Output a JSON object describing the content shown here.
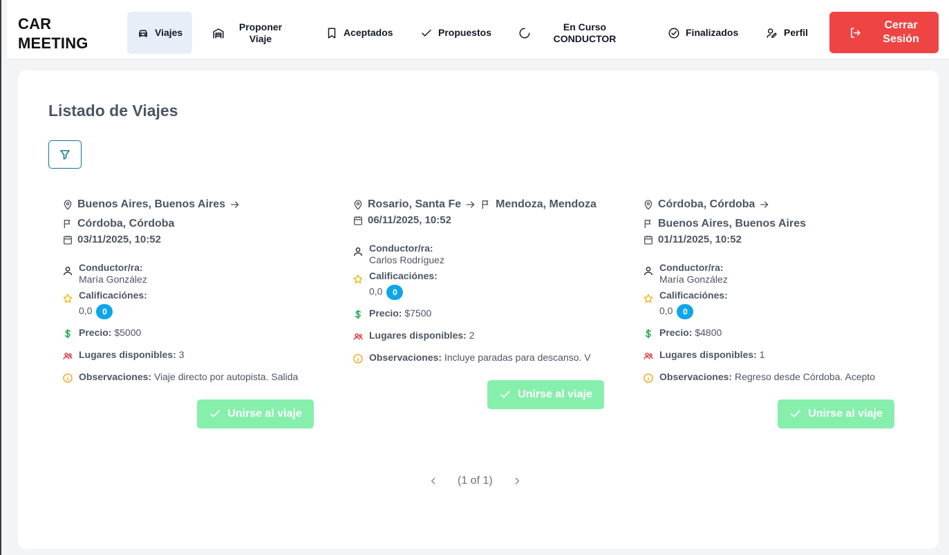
{
  "app": {
    "logo_line1": "CAR",
    "logo_line2": "MEETING"
  },
  "nav": {
    "viajes": "Viajes",
    "proponer_1": "Proponer",
    "proponer_2": "Viaje",
    "aceptados": "Aceptados",
    "propuestos": "Propuestos",
    "encurso_1": "En Curso",
    "encurso_2": "CONDUCTOR",
    "finalizados": "Finalizados",
    "perfil": "Perfil",
    "logout_1": "Cerrar",
    "logout_2": "Sesión"
  },
  "colors": {
    "accent": "#0e7490",
    "logout": "#ef4444",
    "join": "#86efac",
    "badge": "#0ea5e9",
    "active_nav": "#e8eef8"
  },
  "main": {
    "title": "Listado de Viajes"
  },
  "labels": {
    "driver": "Conductor/ra:",
    "ratings": "Calificaciónes:",
    "price": "Precio:",
    "seats": "Lugares disponibles:",
    "notes": "Observaciones:",
    "join": "Unirse al viaje"
  },
  "trips": [
    {
      "origin": "Buenos Aires, Buenos Aires",
      "destination": "Córdoba, Córdoba",
      "date": "03/11/2025, 10:52",
      "driver": "María González",
      "rating": "0,0",
      "rating_count": "0",
      "price": "$5000",
      "seats": "3",
      "notes": "Viaje directo por autopista. Salida"
    },
    {
      "origin": "Rosario, Santa Fe",
      "destination": "Mendoza, Mendoza",
      "date": "06/11/2025, 10:52",
      "driver": "Carlos Rodríguez",
      "rating": "0,0",
      "rating_count": "0",
      "price": "$7500",
      "seats": "2",
      "notes": "Incluye paradas para descanso. V"
    },
    {
      "origin": "Córdoba, Córdoba",
      "destination": "Buenos Aires, Buenos Aires",
      "date": "01/11/2025, 10:52",
      "driver": "María González",
      "rating": "0,0",
      "rating_count": "0",
      "price": "$4800",
      "seats": "1",
      "notes": "Regreso desde Córdoba. Acepto"
    }
  ],
  "pagination": {
    "text": "(1 of 1)"
  }
}
